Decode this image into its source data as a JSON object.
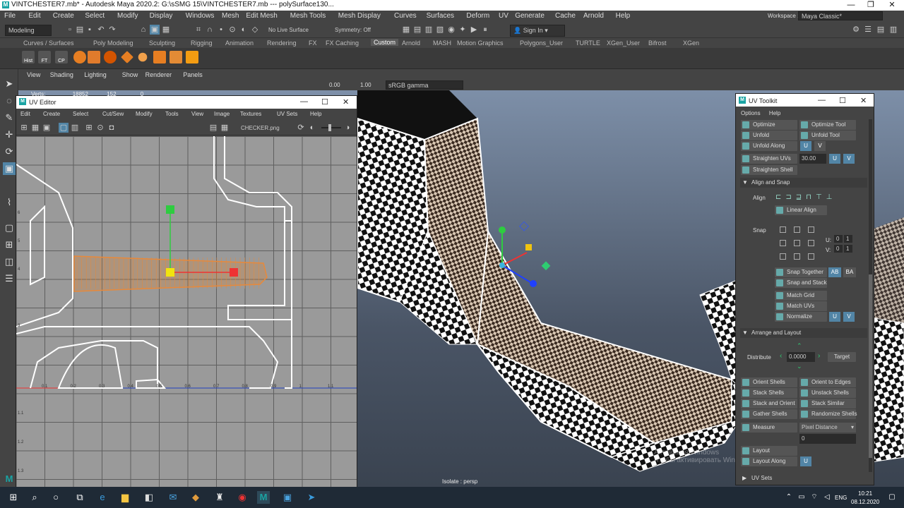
{
  "window": {
    "title": "VINTCHESTER7.mb* - Autodesk Maya 2020.2: G:\\sSMG 15\\VINTCHESTER7.mb  ---  polySurface130..."
  },
  "menubar": [
    "File",
    "Edit",
    "Create",
    "Select",
    "Modify",
    "Display",
    "Windows",
    "Mesh",
    "Edit Mesh",
    "Mesh Tools",
    "Mesh Display",
    "Curves",
    "Surfaces",
    "Deform",
    "UV",
    "Generate",
    "Cache",
    "Arnold",
    "Help"
  ],
  "workspace": {
    "label": "Workspace :",
    "value": "Maya Classic*"
  },
  "statusline": {
    "mode": "Modeling",
    "live_surface": "No Live Surface",
    "symmetry": "Symmetry: Off",
    "sign_in": "Sign In"
  },
  "shelf_tabs": [
    "Curves / Surfaces",
    "Poly Modeling",
    "Sculpting",
    "Rigging",
    "Animation",
    "Rendering",
    "FX",
    "FX Caching",
    "Custom",
    "Arnold",
    "MASH",
    "Motion Graphics",
    "Polygons_User",
    "TURTLE",
    "XGen_User",
    "Bifrost",
    "XGen"
  ],
  "shelf_active": "Custom",
  "shelf_icons": [
    "Hist",
    "FT",
    "CP"
  ],
  "viewport_menu": [
    "View",
    "Shading",
    "Lighting",
    "Show",
    "Renderer",
    "Panels"
  ],
  "viewport_toolbar": {
    "val1": "0.00",
    "val2": "1.00",
    "colorspace": "sRGB gamma"
  },
  "hud": {
    "label": "Verts:",
    "v1": "18852",
    "v2": "152",
    "v3": "0"
  },
  "isolate": "Isolate : persp",
  "uv_editor": {
    "title": "UV Editor",
    "menu": [
      "Edit",
      "Create",
      "Select",
      "Cut/Sew",
      "Modify",
      "Tools",
      "View",
      "Image",
      "Textures",
      "UV Sets",
      "Help"
    ],
    "texture": "CHECKER.png",
    "axis_u": [
      "0.1",
      "0.2",
      "0.3",
      "0.4",
      "0.5",
      "0.6",
      "0.7",
      "0.8",
      "0.9",
      "1",
      "1.1"
    ],
    "axis_v": [
      "6",
      "5",
      "4",
      "3",
      "1.1",
      "1.2",
      "1.3"
    ]
  },
  "uv_toolkit": {
    "title": "UV Toolkit",
    "menu": [
      "Options",
      "Help"
    ],
    "rows": [
      [
        "Optimize",
        "Optimize Tool"
      ],
      [
        "Unfold",
        "Unfold Tool"
      ]
    ],
    "unfold_along": "Unfold Along",
    "u": "U",
    "v": "V",
    "straighten": "Straighten UVs",
    "straighten_val": "30.00",
    "straighten_shell": "Straighten Shell",
    "align_snap": "Align and Snap",
    "align": "Align",
    "linear_align": "Linear Align",
    "snap": "Snap",
    "su": "U:",
    "sv": "V:",
    "zero": "0",
    "one": "1",
    "snap_together": "Snap Together",
    "ab": "AB",
    "ba": "BA",
    "snap_stack": "Snap and Stack",
    "match_grid": "Match Grid",
    "match_uvs": "Match UVs",
    "normalize": "Normalize",
    "arrange": "Arrange and Layout",
    "distribute": "Distribute",
    "dist_val": "0.0000",
    "target": "Target",
    "shell_rows": [
      [
        "Orient Shells",
        "Orient to Edges"
      ],
      [
        "Stack Shells",
        "Unstack Shells"
      ],
      [
        "Stack and Orient",
        "Stack Similar"
      ],
      [
        "Gather Shells",
        "Randomize Shells"
      ]
    ],
    "measure": "Measure",
    "measure_mode": "Pixel Distance",
    "measure_val": "0",
    "layout": "Layout",
    "layout_along": "Layout Along",
    "uv_sets": "UV Sets"
  },
  "watermark": "Активация Windows\nЧтобы активировать Windows, перейдите в раздел \"Параметры\".",
  "taskbar": {
    "lang": "ENG",
    "time": "10:21",
    "date": "08.12.2020"
  }
}
